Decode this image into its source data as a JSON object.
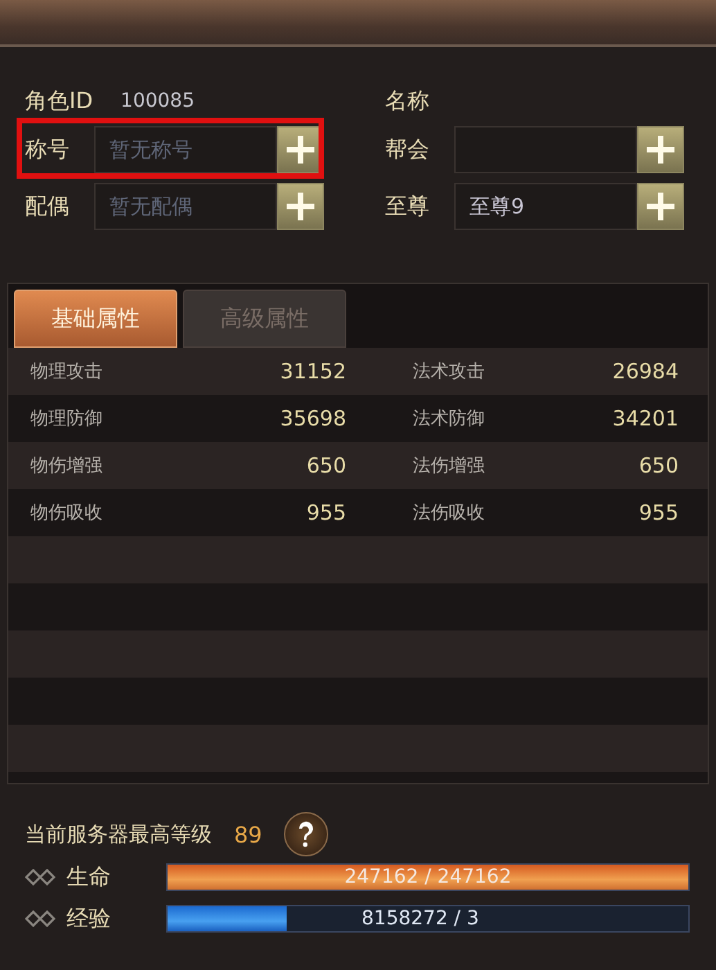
{
  "profile": {
    "left": [
      {
        "kind": "info",
        "label": "角色ID",
        "value": "100085"
      },
      {
        "kind": "field",
        "label": "称号",
        "placeholder": "暂无称号",
        "highlighted": true
      },
      {
        "kind": "field",
        "label": "配偶",
        "placeholder": "暂无配偶",
        "highlighted": false
      }
    ],
    "right": [
      {
        "kind": "info",
        "label": "名称"
      },
      {
        "kind": "field",
        "label": "帮会",
        "highlighted": false
      },
      {
        "kind": "field",
        "label": "至尊",
        "value": "至尊9",
        "highlighted": false
      }
    ]
  },
  "tabs": [
    {
      "label": "基础属性",
      "selected": true
    },
    {
      "label": "高级属性",
      "selected": false
    }
  ],
  "stats": [
    {
      "left_label": "物理攻击",
      "left_value": "31152",
      "right_label": "法术攻击",
      "right_value": "26984"
    },
    {
      "left_label": "物理防御",
      "left_value": "35698",
      "right_label": "法术防御",
      "right_value": "34201"
    },
    {
      "left_label": "物伤增强",
      "left_value": "650",
      "right_label": "法伤增强",
      "right_value": "650"
    },
    {
      "left_label": "物伤吸收",
      "left_value": "955",
      "right_label": "法伤吸收",
      "right_value": "955"
    }
  ],
  "server_level": {
    "label": "当前服务器最高等级",
    "value": "89"
  },
  "bars": [
    {
      "kind": "hp",
      "label": "生命",
      "level": 1.0,
      "reading": "247162 / 247162"
    },
    {
      "kind": "exp",
      "label": "经验",
      "level": 0.23,
      "reading": "8158272 / 3"
    }
  ]
}
